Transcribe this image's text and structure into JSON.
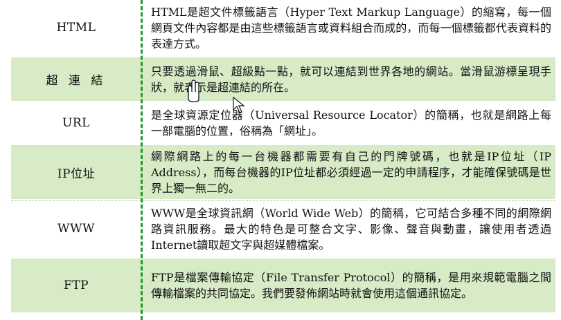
{
  "rows": [
    {
      "term": "HTML",
      "desc": "HTML是超文件標籤語言（Hyper Text Markup Language）的縮寫，每一個網頁文件內容都是由這些標籤語言或資料組合而成的，而每一個標籤都代表資料的表達方式。"
    },
    {
      "term": "超 連 結",
      "desc": "只要透過滑鼠、超級點一點，就可以連結到世界各地的網站。當滑鼠游標呈現手狀，就表示是超連結的所在。"
    },
    {
      "term": "URL",
      "desc": "是全球資源定位器（Universal Resource Locator）的簡稱，也就是網路上每一部電腦的位置，俗稱為「網址」。"
    },
    {
      "term": "IP位址",
      "desc": "網際網路上的每一台機器都需要有自己的門牌號碼，也就是IP位址（IP Address），而每台機器的IP位址都必須經過一定的申請程序，才能確保號碼是世界上獨一無二的。"
    },
    {
      "term": "WWW",
      "desc": "WWW是全球資訊網（World Wide Web）的簡稱，它可結合多種不同的網際網路資訊服務。最大的特色是可整合文字、影像、聲音與動畫，讓使用者透過Internet讀取超文字與超媒體檔案。"
    },
    {
      "term": "FTP",
      "desc": "FTP是檔案傳輸協定（File Transfer Protocol）的簡稱，是用來規範電腦之間傳輸檔案的共同協定。我們要發佈網站時就會使用這個通訊協定。"
    }
  ],
  "icons": {
    "hand": "hand-pointer-icon",
    "arrow": "arrow-cursor-icon"
  },
  "colors": {
    "shade": "#d7ebc6",
    "divider": "#1f9a2a"
  }
}
